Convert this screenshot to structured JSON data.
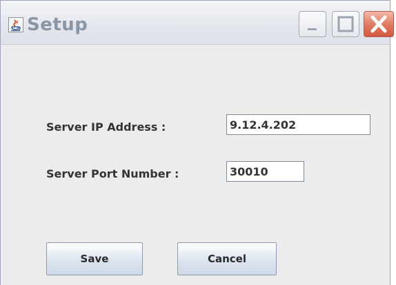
{
  "window": {
    "title": "Setup",
    "buttons": {
      "minimize_icon": "minimize-icon",
      "maximize_icon": "maximize-icon",
      "close_icon": "close-icon"
    }
  },
  "form": {
    "ip_label": "Server IP Address :",
    "ip_value": "9.12.4.202",
    "port_label": "Server Port Number :",
    "port_value": "30010"
  },
  "actions": {
    "save_label": "Save",
    "cancel_label": "Cancel"
  },
  "colors": {
    "title_text": "#8a95a6",
    "close_button": "#e07760",
    "window_bg": "#ececec"
  }
}
